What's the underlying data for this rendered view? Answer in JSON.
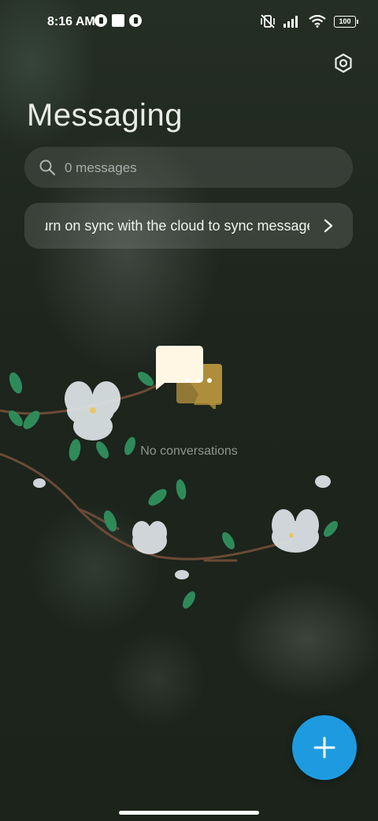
{
  "status_bar": {
    "time": "8:16 AM",
    "battery": "100",
    "icons": [
      "notification-icon",
      "square-notification-icon",
      "notification-icon",
      "vibrate-off-icon",
      "signal-icon",
      "wifi-icon",
      "battery-icon"
    ]
  },
  "header": {
    "title": "Messaging",
    "settings_icon": "settings-hex-icon"
  },
  "search": {
    "placeholder": "0 messages"
  },
  "sync_banner": {
    "text": "Turn on sync with the cloud to sync messages"
  },
  "empty_state": {
    "text": "No conversations",
    "icon": "chat-bubbles-icon"
  },
  "fab": {
    "icon": "plus-icon",
    "color": "#1e9be0"
  }
}
